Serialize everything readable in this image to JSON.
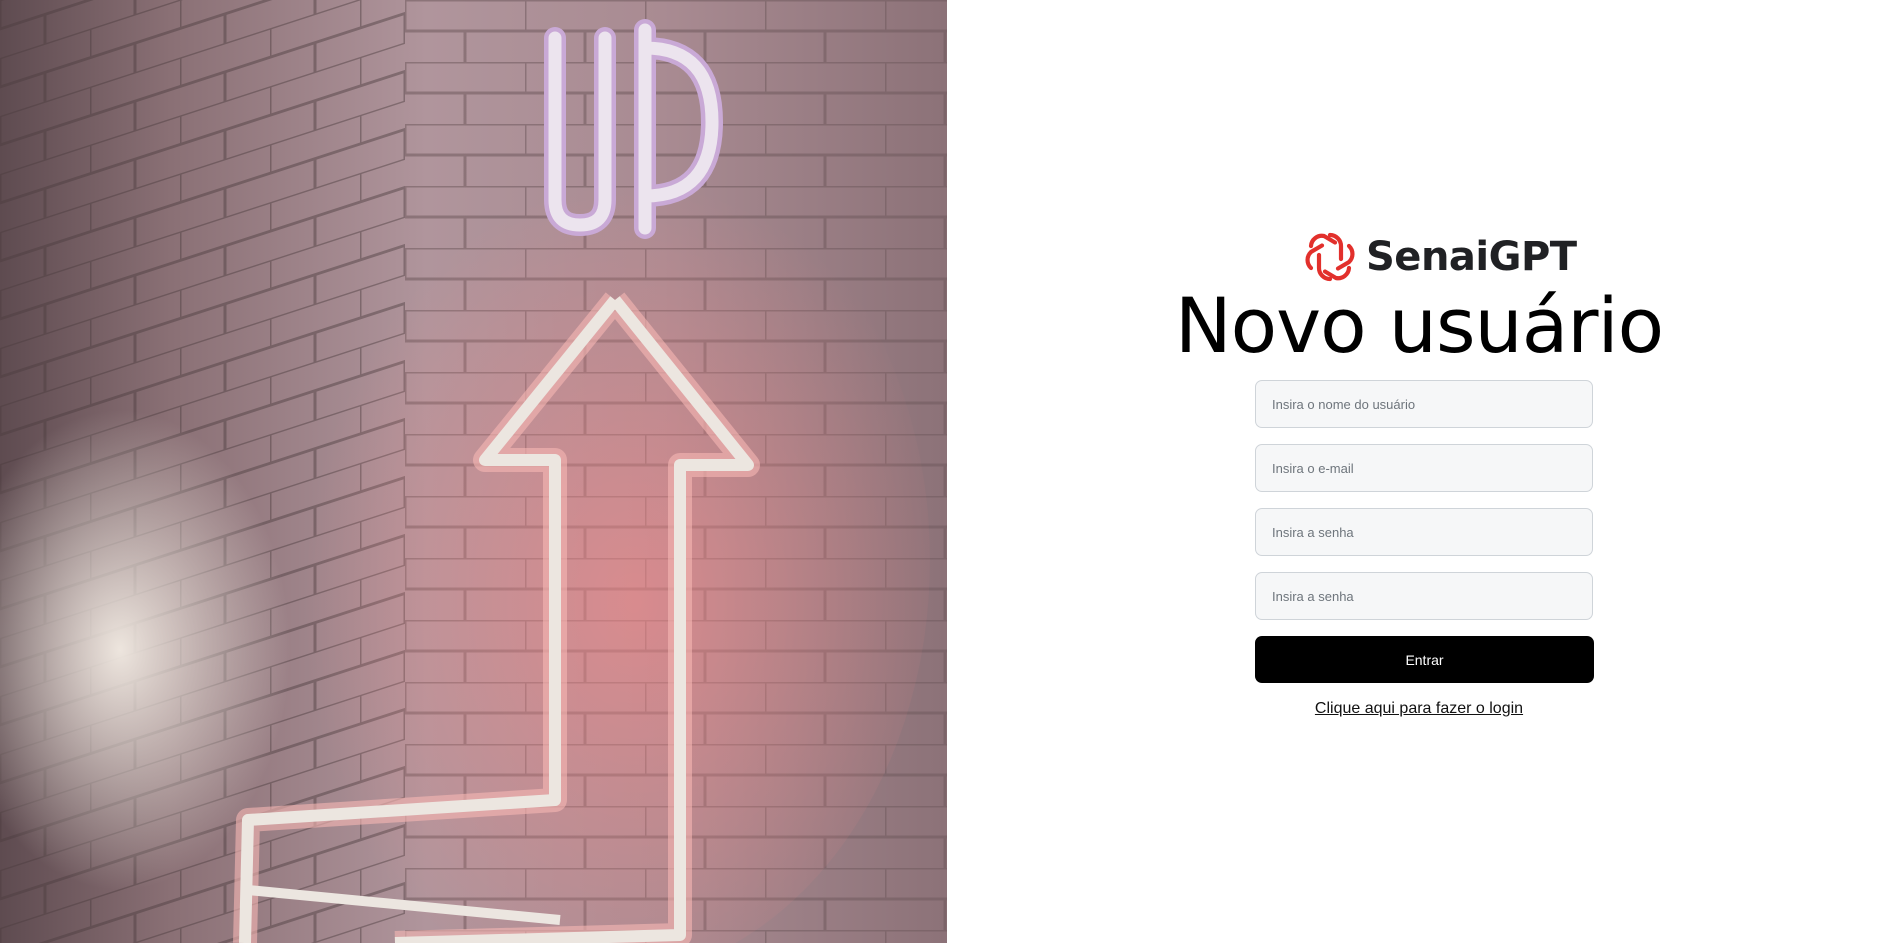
{
  "hero": {
    "sign_text": "UP",
    "accent_color": "#f08a8a"
  },
  "brand": {
    "name": "SenaiGPT",
    "logo_icon": "openai-knot-icon",
    "logo_color": "#e2302c"
  },
  "form": {
    "title": "Novo usuário",
    "username_placeholder": "Insira o nome do usuário",
    "email_placeholder": "Insira o e-mail",
    "password_placeholder": "Insira a senha",
    "password_confirm_placeholder": "Insira a senha",
    "submit_label": "Entrar",
    "login_link": "Clique aqui para fazer o login"
  }
}
